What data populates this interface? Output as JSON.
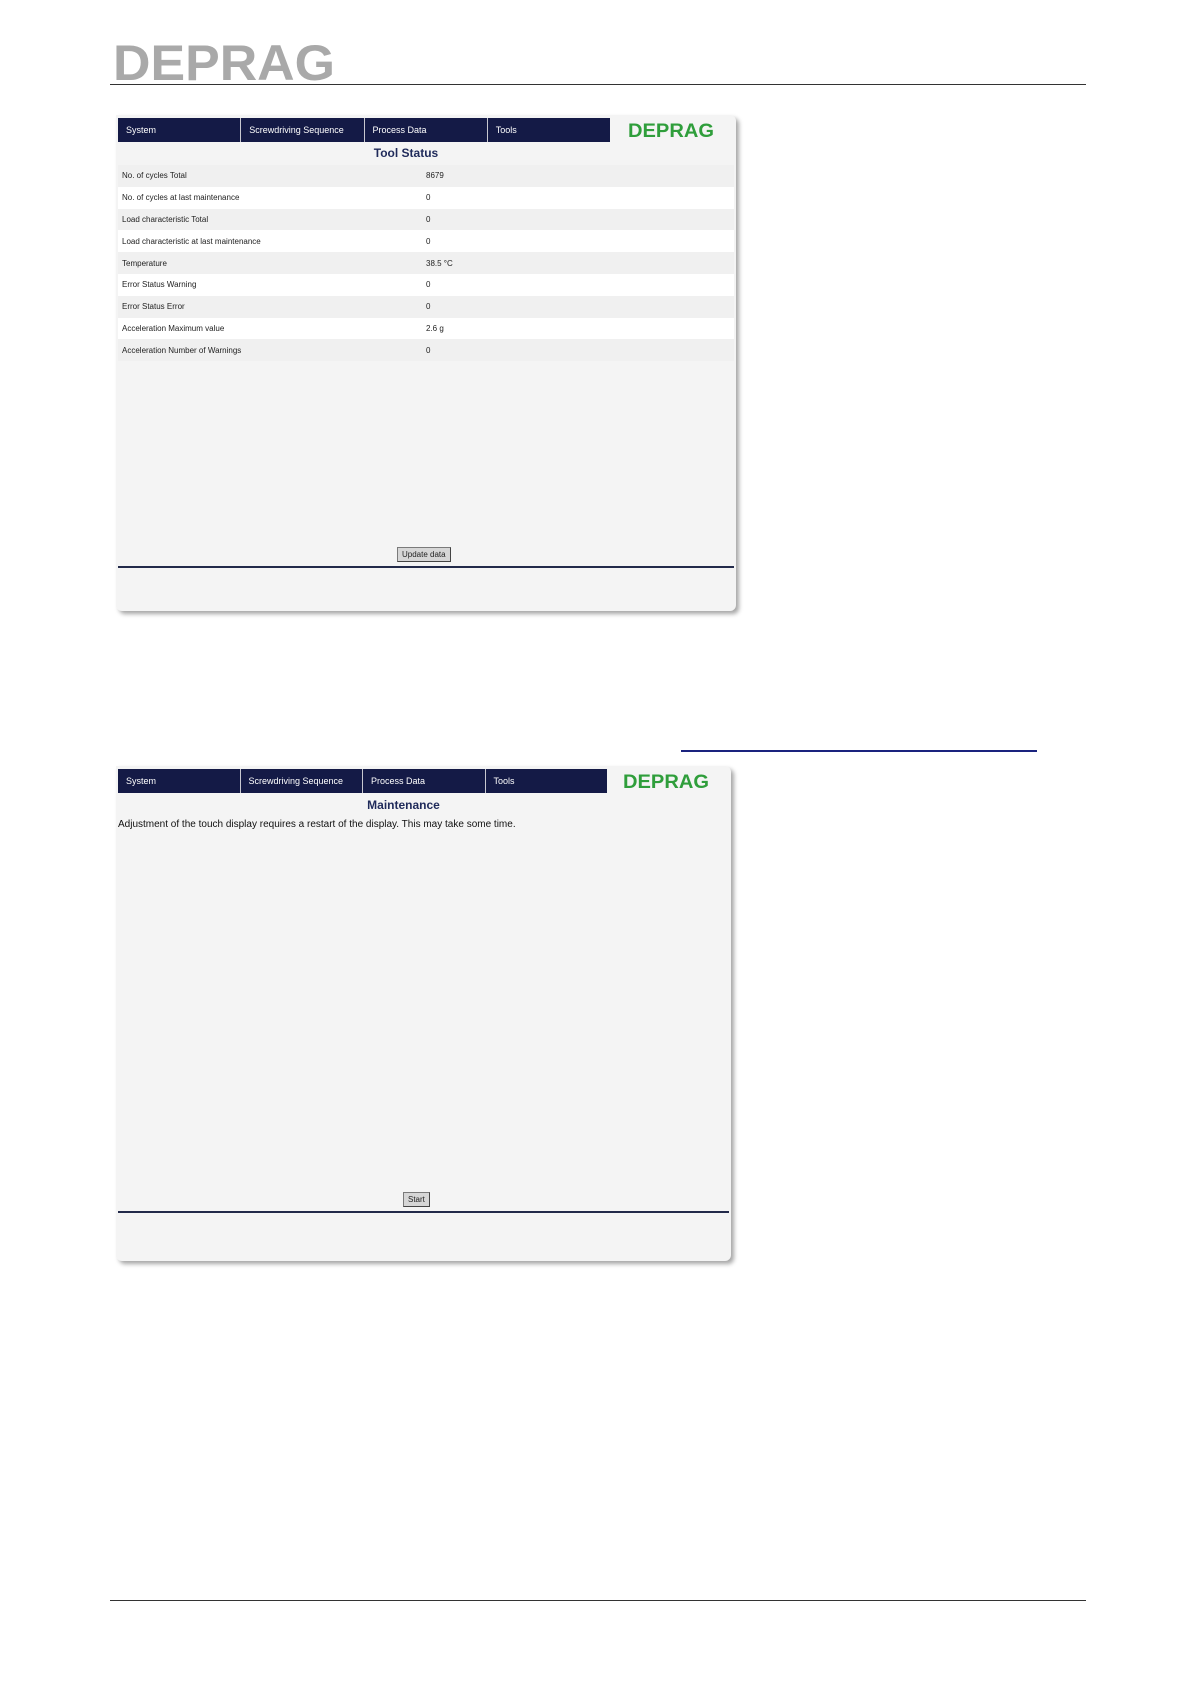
{
  "document": {
    "logo_text": "DEPRAG"
  },
  "tool_status_screen": {
    "nav": [
      "System",
      "Screwdriving Sequence",
      "Process Data",
      "Tools"
    ],
    "logo_text": "DEPRAG",
    "title": "Tool Status",
    "rows": [
      {
        "label": "No. of cycles Total",
        "value": "8679"
      },
      {
        "label": "No. of cycles at last maintenance",
        "value": "0"
      },
      {
        "label": "Load characteristic Total",
        "value": "0"
      },
      {
        "label": "Load characteristic at last maintenance",
        "value": "0"
      },
      {
        "label": "Temperature",
        "value": "38.5 °C"
      },
      {
        "label": "Error Status Warning",
        "value": "0"
      },
      {
        "label": "Error Status Error",
        "value": "0"
      },
      {
        "label": "Acceleration Maximum value",
        "value": "2.6 g"
      },
      {
        "label": "Acceleration Number of Warnings",
        "value": "0"
      }
    ],
    "button_label": "Update data"
  },
  "maintenance_screen": {
    "nav": [
      "System",
      "Screwdriving Sequence",
      "Process Data",
      "Tools"
    ],
    "logo_text": "DEPRAG",
    "title": "Maintenance",
    "message": "Adjustment of the touch display requires a restart of the display. This may take some time.",
    "button_label": "Start"
  },
  "colors": {
    "nav_background": "#141a46",
    "logo_green": "#2f9e3b",
    "document_logo_gray": "#a9a9a9"
  }
}
